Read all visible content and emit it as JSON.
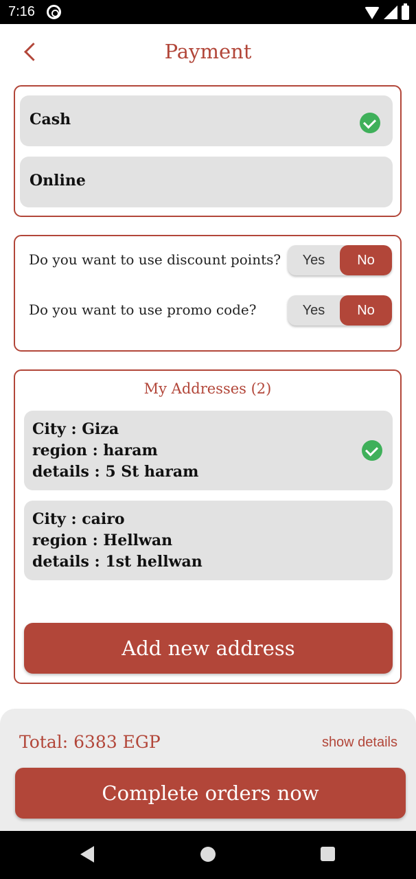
{
  "status_bar": {
    "time": "7:16"
  },
  "header": {
    "title": "Payment"
  },
  "payment_methods": [
    {
      "label": "Cash",
      "selected": true
    },
    {
      "label": "Online",
      "selected": false
    }
  ],
  "questions": [
    {
      "text": "Do you want to use discount points?",
      "yes_label": "Yes",
      "no_label": "No",
      "selected": "No"
    },
    {
      "text": "Do you want to use promo code?",
      "yes_label": "Yes",
      "no_label": "No",
      "selected": "No"
    }
  ],
  "addresses": {
    "title": "My Addresses (2)",
    "items": [
      {
        "city": "City : Giza",
        "region": "region : haram",
        "details": "details : 5 St haram",
        "selected": true
      },
      {
        "city": "City : cairo",
        "region": "region : Hellwan",
        "details": "details : 1st hellwan",
        "selected": false
      }
    ],
    "add_button": "Add new address"
  },
  "footer": {
    "total": "Total: 6383 EGP",
    "show_details": "show details",
    "complete_button": "Complete orders now"
  },
  "colors": {
    "accent": "#b24639",
    "option_bg": "#e2e2e2",
    "check": "#3fb05a",
    "panel_bg": "#ececec"
  },
  "icons": [
    "back-icon",
    "check-icon",
    "wifi-icon",
    "signal-icon",
    "battery-icon",
    "nav-back-icon",
    "nav-home-icon",
    "nav-recents-icon"
  ]
}
